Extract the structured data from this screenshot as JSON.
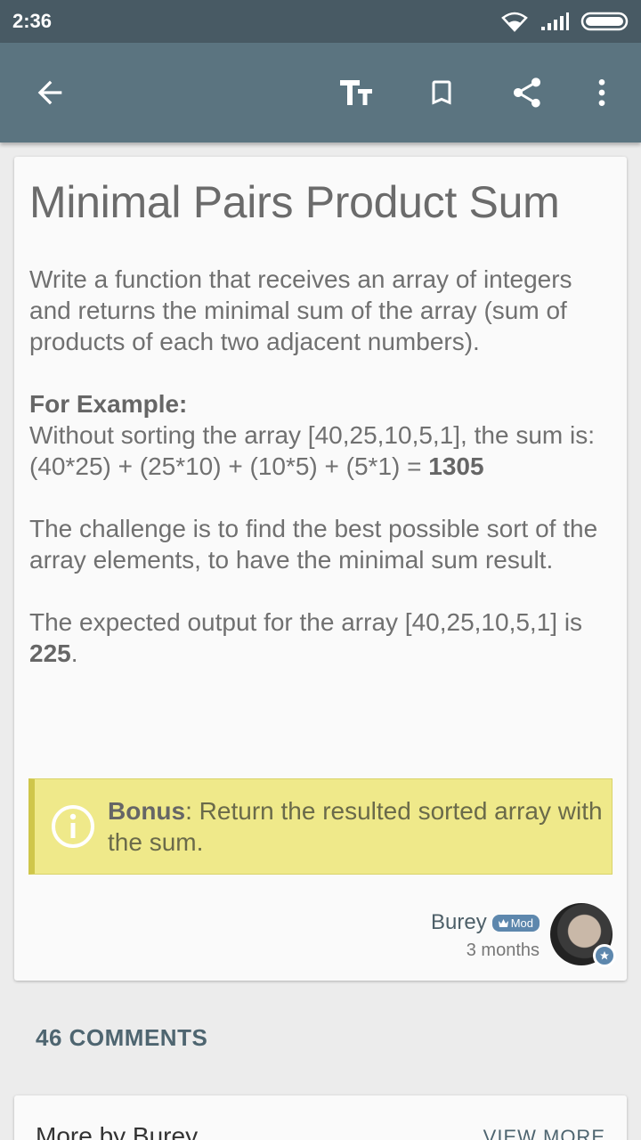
{
  "status_bar": {
    "time": "2:36"
  },
  "colors": {
    "status_bar": "#485a64",
    "app_bar": "#5b7480",
    "bonus_bg": "#efe98a",
    "accent": "#5d87ad"
  },
  "toolbar": {
    "icons": [
      "back-arrow-icon",
      "text-size-icon",
      "bookmark-icon",
      "share-icon",
      "more-vert-icon"
    ]
  },
  "article": {
    "title": "Minimal Pairs Product Sum",
    "intro": "Write a function that receives an array of integers and returns the minimal sum of the array (sum of products of each two adjacent numbers).",
    "example_heading": "For Example:",
    "example_text": "Without sorting the array [40,25,10,5,1], the sum is:",
    "example_formula": "(40*25) + (25*10) + (10*5) + (5*1) = ",
    "example_result": "1305",
    "challenge": "The challenge is to find the best possible sort of the array elements, to have the minimal sum result.",
    "expected_prefix": "The expected output for the array [40,25,10,5,1] is ",
    "expected_value": "225",
    "expected_suffix": ".",
    "bonus_label": "Bonus",
    "bonus_text": ": Return the resulted sorted array with the sum."
  },
  "author": {
    "name": "Burey",
    "badge": "Mod",
    "time": "3 months"
  },
  "comments": {
    "label": "46 COMMENTS"
  },
  "more": {
    "title": "More by Burey",
    "view_more": "VIEW MORE"
  }
}
